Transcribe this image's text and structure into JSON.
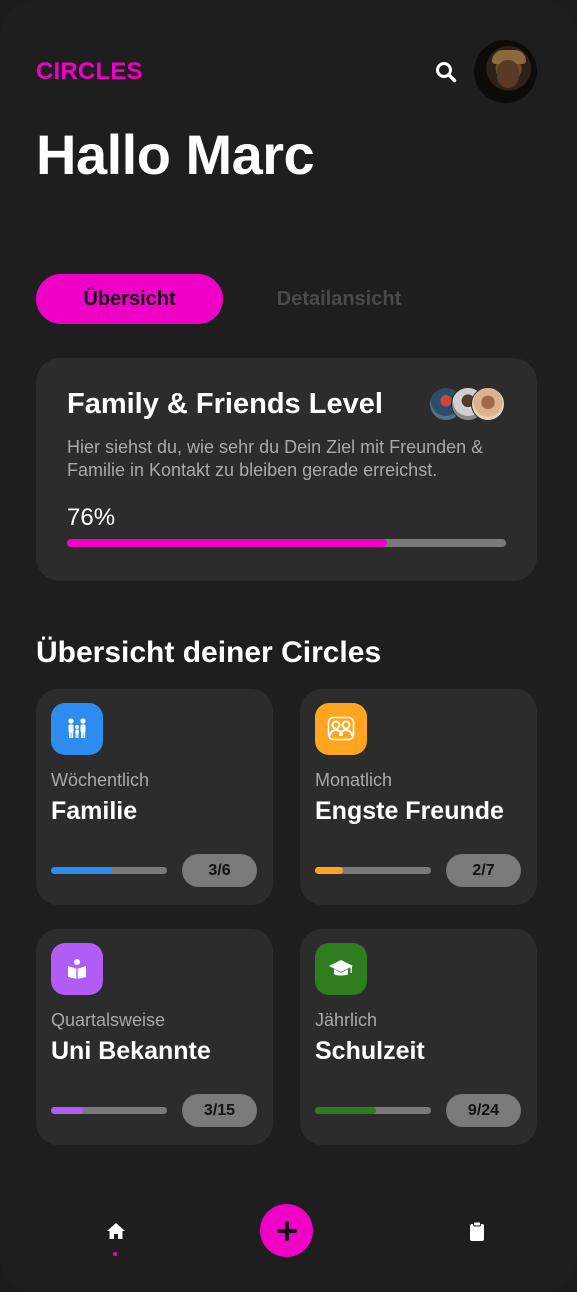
{
  "header": {
    "brand": "CIRCLES",
    "greeting": "Hallo Marc",
    "search_icon": "search-icon",
    "avatar": "user-avatar"
  },
  "tabs": [
    {
      "label": "Übersicht",
      "active": true
    },
    {
      "label": "Detailansicht",
      "active": false
    }
  ],
  "level": {
    "title": "Family & Friends Level",
    "description": "Hier siehst du, wie sehr du Dein Ziel mit Freunden & Familie in Kontakt zu bleiben gerade erreichst.",
    "percent_label": "76%",
    "progress": 0.73
  },
  "circles_section": {
    "title": "Übersicht deiner Circles",
    "items": [
      {
        "frequency": "Wöchentlich",
        "name": "Familie",
        "count": "3/6",
        "progress": 0.53,
        "color": "#2d8cf0",
        "icon": "family-icon"
      },
      {
        "frequency": "Monatlich",
        "name": "Engste Freunde",
        "count": "2/7",
        "progress": 0.24,
        "color": "#ffa51f",
        "icon": "friends-icon"
      },
      {
        "frequency": "Quartalsweise",
        "name": "Uni Bekannte",
        "count": "3/15",
        "progress": 0.28,
        "color": "#b25cf6",
        "icon": "book-icon"
      },
      {
        "frequency": "Jährlich",
        "name": "Schulzeit",
        "count": "9/24",
        "progress": 0.53,
        "color": "#2e7d1f",
        "icon": "graduation-cap-icon"
      }
    ]
  },
  "colors": {
    "accent": "#ee00c6",
    "background": "#1e1e1e",
    "card": "#2c2c2c",
    "muted_text": "#a9a9a9"
  },
  "bottom_nav": {
    "home_icon": "home-icon",
    "add_icon": "plus-icon",
    "clipboard_icon": "clipboard-icon"
  }
}
